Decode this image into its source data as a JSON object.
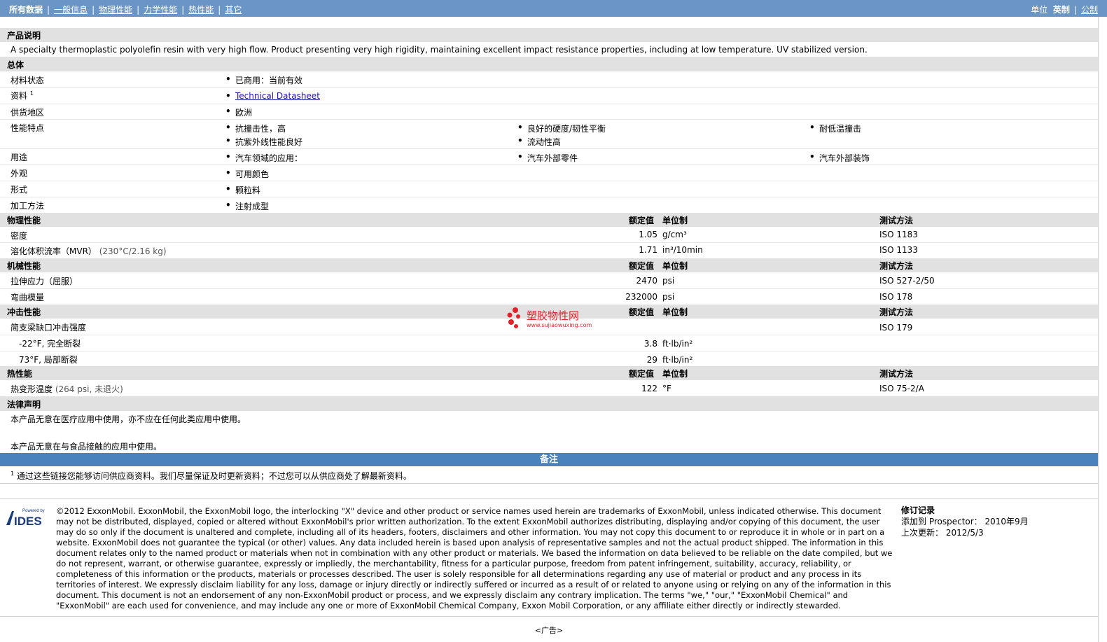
{
  "nav": {
    "tabs": [
      "所有数据",
      "一般信息",
      "物理性能",
      "力学性能",
      "热性能",
      "其它"
    ],
    "unit_label": "单位",
    "unit_options": [
      "英制",
      "公制"
    ]
  },
  "product_description": {
    "heading": "产品说明",
    "text": "A specialty thermoplastic polyolefin resin with very high flow. Product presenting very high rigidity, maintaining excellent impact resistance properties, including at low temperature. UV stabilized version."
  },
  "general": {
    "heading": "总体",
    "rows": [
      {
        "label": "材料状态",
        "items": [
          "已商用：当前有效"
        ]
      },
      {
        "label": "资料",
        "sup": "1",
        "items": [
          "Technical Datasheet"
        ]
      },
      {
        "label": "供货地区",
        "items": [
          "欧洲"
        ]
      },
      {
        "label": "性能特点",
        "items": [
          "抗撞击性，高",
          "良好的硬度/韧性平衡",
          "耐低温撞击",
          "抗紫外线性能良好",
          "流动性高"
        ]
      },
      {
        "label": "用途",
        "items": [
          "汽车领域的应用：",
          "汽车外部零件",
          "汽车外部装饰"
        ]
      },
      {
        "label": "外观",
        "items": [
          "可用颜色"
        ]
      },
      {
        "label": "形式",
        "items": [
          "颗粒料"
        ]
      },
      {
        "label": "加工方法",
        "items": [
          "注射成型"
        ]
      }
    ]
  },
  "columns": {
    "nominal": "额定值",
    "unit": "单位制",
    "test": "测试方法"
  },
  "physical": {
    "heading": "物理性能",
    "rows": [
      {
        "label": "密度",
        "cond": "",
        "value": "1.05",
        "unit": "g/cm³",
        "test": "ISO 1183"
      },
      {
        "label": "溶化体积流率（MVR）",
        "cond": "(230°C/2.16 kg)",
        "value": "1.71",
        "unit": "in³/10min",
        "test": "ISO 1133"
      }
    ]
  },
  "mechanical": {
    "heading": "机械性能",
    "rows": [
      {
        "label": "拉伸应力（屈服）",
        "value": "2470",
        "unit": "psi",
        "test": "ISO 527-2/50"
      },
      {
        "label": "弯曲模量",
        "value": "232000",
        "unit": "psi",
        "test": "ISO 178"
      }
    ]
  },
  "impact": {
    "heading": "冲击性能",
    "rows": [
      {
        "label": "简支梁缺口冲击强度",
        "value": "",
        "unit": "",
        "test": "ISO 179"
      },
      {
        "label": "-22°F, 完全断裂",
        "value": "3.8",
        "unit": "ft·lb/in²",
        "test": ""
      },
      {
        "label": "73°F, 局部断裂",
        "value": "29",
        "unit": "ft·lb/in²",
        "test": ""
      }
    ]
  },
  "thermal": {
    "heading": "热性能",
    "rows": [
      {
        "label": "热变形温度",
        "cond": "(264 psi, 未退火)",
        "value": "122",
        "unit": "°F",
        "test": "ISO 75-2/A"
      }
    ]
  },
  "legal": {
    "heading": "法律声明",
    "lines": [
      "本产品无意在医疗应用中使用，亦不应在任何此类应用中使用。",
      "本产品无意在与食品接触的应用中使用。"
    ]
  },
  "notes": {
    "heading": "备注",
    "sup": "1",
    "text": "通过这些链接您能够访问供应商资料。我们尽量保证及时更新资料；不过您可以从供应商处了解最新资料。"
  },
  "footer": {
    "logo_small": "Powered by",
    "logo_big": "IDES",
    "copyright": "©2012 ExxonMobil. ExxonMobil, the ExxonMobil logo, the interlocking \"X\" device and other product or service names used herein are trademarks of ExxonMobil, unless indicated otherwise. This document may not be distributed, displayed, copied or altered without ExxonMobil's prior written authorization. To the extent ExxonMobil authorizes distributing, displaying and/or copying of this document, the user may do so only if the document is unaltered and complete, including all of its headers, footers, disclaimers and other information. You may not copy this document to or reproduce it in whole or in part on a website. ExxonMobil does not guarantee the typical (or other) values. Any data included herein is based upon analysis of representative samples and not the actual product shipped. The information in this document relates only to the named product or materials when not in combination with any other product or materials. We based the information on data believed to be reliable on the date compiled, but we do not represent, warrant, or otherwise guarantee, expressly or impliedly, the merchantability, fitness for a particular purpose, freedom from patent infringement, suitability, accuracy, reliability, or completeness of this information or the products, materials or processes described. The user is solely responsible for all determinations regarding any use of material or product and any process in its territories of interest. We expressly disclaim liability for any loss, damage or injury directly or indirectly suffered or incurred as a result of or related to anyone using or relying on any of the information in this document. This document is not an endorsement of any non-ExxonMobil product or process, and we expressly disclaim any contrary implication. The terms \"we,\" \"our,\" \"ExxonMobil Chemical\" and \"ExxonMobil\" are each used for convenience, and may include any one or more of ExxonMobil Chemical Company, Exxon Mobil Corporation, or any affiliate either directly or indirectly stewarded.",
    "revision_heading": "修订记录",
    "added_label": "添加到 Prospector：",
    "added_value": "2010年9月",
    "updated_label": "上次更新：",
    "updated_value": "2012/5/3",
    "ad": "<广告>"
  },
  "watermark": {
    "name": "塑胶物性网",
    "url": "www.sujiaowuxing.com"
  },
  "colors": {
    "topbar": "#6a95c4",
    "notebar": "#4a82bd",
    "section_bg": "#e1e1e1",
    "watermark": "#e0222a"
  }
}
